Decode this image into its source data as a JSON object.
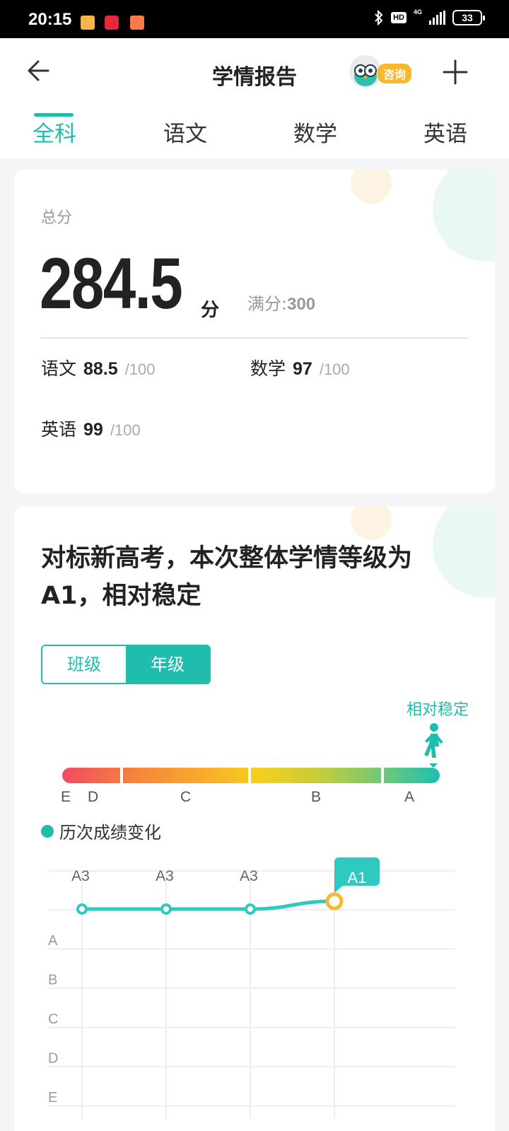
{
  "status_bar": {
    "time": "20:15",
    "hd": "HD",
    "network": "4G",
    "battery": "33",
    "icons": [
      "message-notification-icon",
      "netease-music-icon",
      "shopping-bag-icon",
      "bluetooth-icon"
    ]
  },
  "header": {
    "title": "学情报告",
    "consult": "咨询"
  },
  "tabs": [
    "全科",
    "语文",
    "数学",
    "英语"
  ],
  "score": {
    "label": "总分",
    "total": "284.5",
    "unit": "分",
    "full_label": "满分:",
    "full_value": "300",
    "subjects": [
      {
        "name": "语文",
        "value": "88.5",
        "max": "/100"
      },
      {
        "name": "数学",
        "value": "97",
        "max": "/100"
      },
      {
        "name": "英语",
        "value": "99",
        "max": "/100"
      }
    ]
  },
  "level": {
    "headline": "对标新高考，本次整体学情等级为A1，相对稳定",
    "seg_class": "班级",
    "seg_grade": "年级",
    "tag": "相对稳定",
    "grades": [
      "E",
      "D",
      "C",
      "B",
      "A"
    ],
    "legend": "历次成绩变化"
  },
  "colors": {
    "accent": "#20bcad",
    "highlight": "#f5b82e"
  },
  "chart_data": {
    "type": "line",
    "x": [
      "",
      "",
      "",
      ""
    ],
    "y_levels": [
      "A",
      "B",
      "C",
      "D",
      "E"
    ],
    "series": [
      {
        "values": [
          "A3",
          "A3",
          "A3",
          "A1"
        ]
      }
    ],
    "data_labels": [
      "A3",
      "A3",
      "A3",
      "A1"
    ]
  }
}
